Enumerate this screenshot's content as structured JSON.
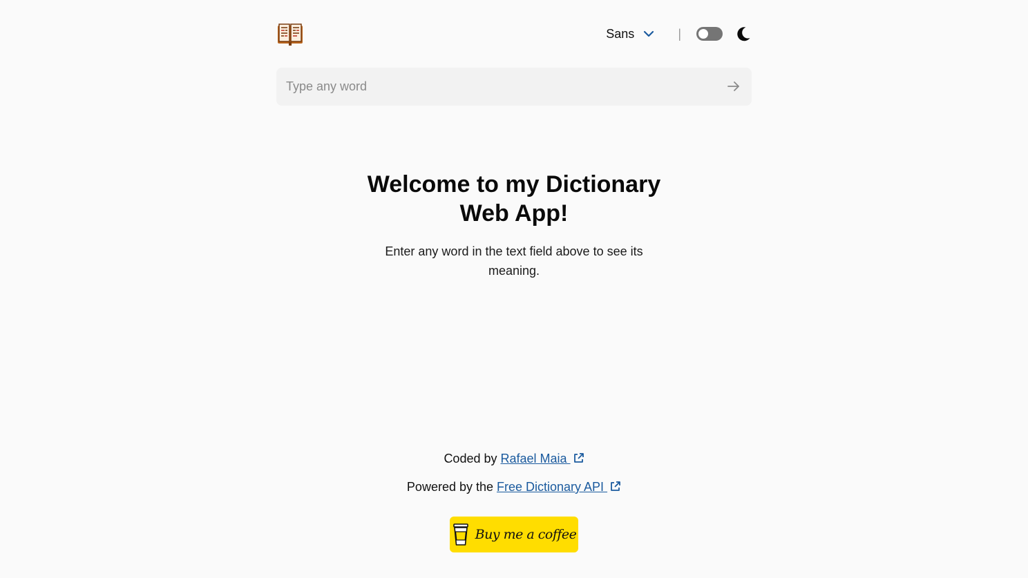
{
  "header": {
    "logo_icon": "book-icon",
    "font_select": {
      "selected": "Sans",
      "icon": "chevron-down-icon"
    },
    "divider": "|",
    "theme_toggle": {
      "state": "off",
      "icon": "moon-icon"
    }
  },
  "search": {
    "placeholder": "Type any word",
    "value": "",
    "submit_icon": "arrow-right-icon"
  },
  "welcome": {
    "title": "Welcome to my Dictionary Web App!",
    "subtitle": "Enter any word in the text field above to see its meaning."
  },
  "footer": {
    "coded_by_prefix": "Coded by ",
    "coded_by_link": "Rafael Maia ",
    "powered_by_prefix": "Powered by the ",
    "powered_by_link": "Free Dictionary API ",
    "link_icon": "external-link-icon",
    "coffee_button": "Buy me a coffee",
    "coffee_icon": "coffee-cup-icon"
  },
  "colors": {
    "background": "#fafafa",
    "accent": "#1a5a9e",
    "coffee_button": "#ffdd00"
  }
}
